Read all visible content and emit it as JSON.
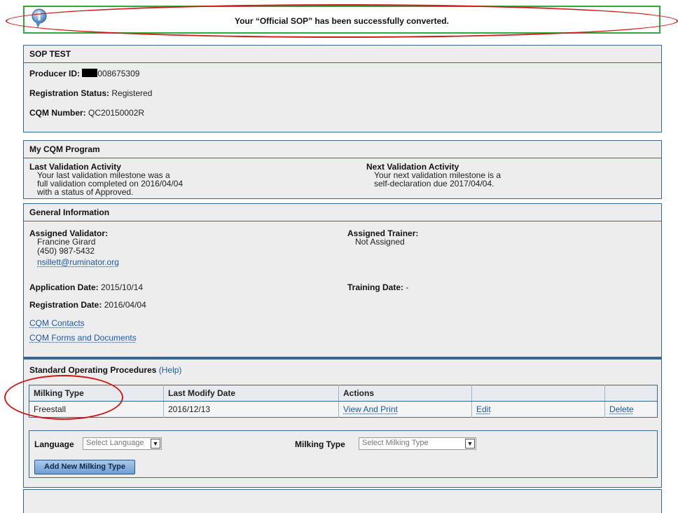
{
  "notification": {
    "message": "Your “Official SOP” has been successfully converted.",
    "icon": "info-icon"
  },
  "producer": {
    "title": "SOP TEST",
    "producer_id_label": "Producer ID:",
    "producer_id_value": "008675309",
    "registration_status_label": "Registration Status:",
    "registration_status_value": "Registered",
    "cqm_number_label": "CQM Number:",
    "cqm_number_value": "QC20150002R"
  },
  "program": {
    "title": "My CQM Program",
    "last_label": "Last Validation Activity",
    "last_lines": [
      "Your last validation milestone was a",
      "full validation completed on 2016/04/04",
      "with a status of Approved."
    ],
    "next_label": "Next Validation Activity",
    "next_lines": [
      "Your next validation milestone is a",
      "self-declaration due 2017/04/04."
    ]
  },
  "general": {
    "title": "General Information",
    "validator_label": "Assigned Validator:",
    "validator_name": "Francine Girard",
    "validator_phone": "(450) 987-5432",
    "validator_email": "nsillett@ruminator.org",
    "trainer_label": "Assigned Trainer:",
    "trainer_value": "Not Assigned",
    "application_date_label": "Application Date:",
    "application_date_value": "2015/10/14",
    "training_date_label": "Training Date:",
    "training_date_value": "-",
    "registration_date_label": "Registration Date:",
    "registration_date_value": "2016/04/04",
    "contacts_link": "CQM Contacts",
    "forms_link": "CQM Forms and Documents"
  },
  "sop": {
    "title": "Standard Operating Procedures",
    "help_link": "(Help)",
    "columns": [
      "Milking Type",
      "Last Modify Date",
      "Actions",
      "",
      ""
    ],
    "rows": [
      {
        "milking_type": "Freestall",
        "last_modify": "2016/12/13",
        "view": "View And Print",
        "edit": "Edit",
        "delete": "Delete"
      }
    ],
    "language_label": "Language",
    "language_placeholder": "Select Language",
    "milking_type_label": "Milking Type",
    "milking_type_placeholder": "Select Milking Type",
    "add_button": "Add New Milking Type"
  },
  "colors": {
    "border_blue": "#3a6790",
    "link_blue": "#1d5aa8",
    "highlight_red": "#d21919",
    "success_green": "#2eaa3a"
  }
}
